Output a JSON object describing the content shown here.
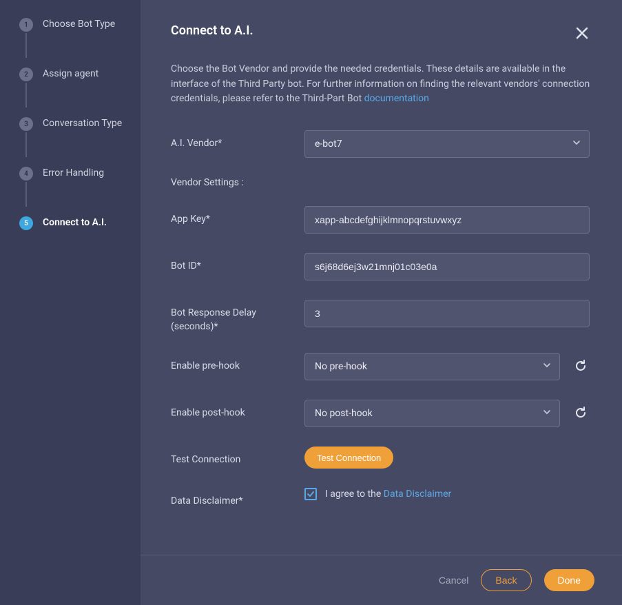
{
  "sidebar": {
    "steps": [
      {
        "num": "1",
        "label": "Choose Bot Type"
      },
      {
        "num": "2",
        "label": "Assign agent"
      },
      {
        "num": "3",
        "label": "Conversation Type"
      },
      {
        "num": "4",
        "label": "Error Handling"
      },
      {
        "num": "5",
        "label": "Connect to A.I."
      }
    ],
    "active_index": 4
  },
  "header": {
    "title": "Connect to A.I."
  },
  "description": {
    "text_before": "Choose the Bot Vendor and provide the needed credentials. These details are available in the interface of the Third Party bot. For further information on finding the relevant vendors' connection credentials, please refer to the Third-Part Bot ",
    "link_text": "documentation"
  },
  "form": {
    "ai_vendor": {
      "label": "A.I. Vendor*",
      "value": "e-bot7"
    },
    "vendor_settings_label": "Vendor Settings :",
    "app_key": {
      "label": "App Key*",
      "value": "xapp-abcdefghijklmnopqrstuvwxyz"
    },
    "bot_id": {
      "label": "Bot ID*",
      "value": "s6j68d6ej3w21mnj01c03e0a"
    },
    "delay": {
      "label": "Bot Response Delay (seconds)*",
      "value": "3"
    },
    "pre_hook": {
      "label": "Enable pre-hook",
      "value": "No pre-hook"
    },
    "post_hook": {
      "label": "Enable post-hook",
      "value": "No post-hook"
    },
    "test": {
      "label": "Test Connection",
      "button": "Test Connection"
    },
    "disclaimer": {
      "label": "Data Disclaimer*",
      "checked": true,
      "text_before": "I agree to the ",
      "link_text": "Data Disclaimer"
    }
  },
  "footer": {
    "cancel": "Cancel",
    "back": "Back",
    "done": "Done"
  }
}
